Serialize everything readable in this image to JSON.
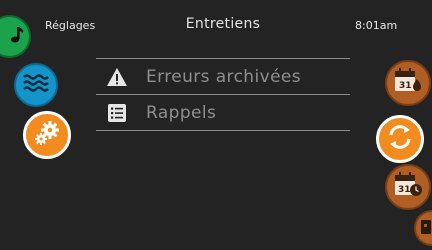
{
  "status_bar": {
    "back_label": "Réglages",
    "title": "Entretiens",
    "clock": "8:01am"
  },
  "left_nav": {
    "music_icon": "music-note-icon",
    "water_icon": "water-waves-icon",
    "settings_icon": "gears-icon"
  },
  "right_nav": {
    "calendar_drop_icon": "calendar-drop-icon",
    "calendar_drop_day": "31",
    "cycle_icon": "cycle-arrows-icon",
    "calendar_clock_icon": "calendar-clock-icon",
    "calendar_clock_day": "31"
  },
  "menu": {
    "items": [
      {
        "label": "Erreurs archivées",
        "icon": "warning-icon"
      },
      {
        "label": "Rappels",
        "icon": "list-icon"
      }
    ]
  },
  "colors": {
    "background": "#232323",
    "accent_orange": "#f28c1f",
    "brown": "#b05e24",
    "blue": "#1494c9",
    "green": "#1aa34a",
    "menu_text": "#8f8f8f"
  }
}
